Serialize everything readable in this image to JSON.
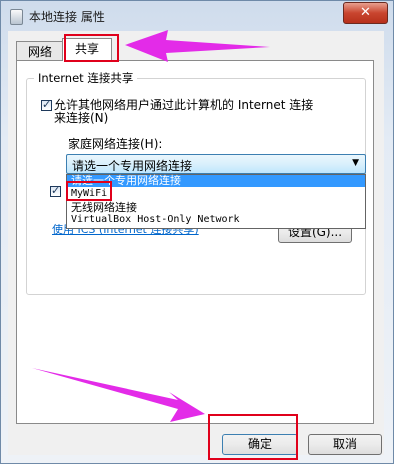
{
  "window": {
    "title": "本地连接 属性",
    "close_glyph": "✕"
  },
  "tabs": [
    {
      "label": "网络",
      "active": false
    },
    {
      "label": "共享",
      "active": true
    }
  ],
  "sharing": {
    "group_title": "Internet 连接共享",
    "allow_checkbox": {
      "checked": true,
      "label_line1": "允许其他网络用户通过此计算机的 Internet 连接",
      "label_line2": "来连接(N)"
    },
    "home_network_label": "家庭网络连接(H):",
    "home_network_select": {
      "value": "请选一个专用网络连接",
      "options": [
        "请选一个专用网络连接",
        "MyWiFi",
        "无线网络连接",
        "VirtualBox Host-Only Network"
      ],
      "highlighted_index": 0
    },
    "control_checkbox": {
      "checked": true
    },
    "ics_link": "使用 ICS (Internet 连接共享)",
    "settings_button": "设置(G)..."
  },
  "footer": {
    "ok_button": "确定",
    "cancel_button": "取消"
  },
  "colors": {
    "annotation": "#e0001b",
    "arrow": "#e32be8",
    "highlight": "#3399ff",
    "link": "#0066cc"
  }
}
